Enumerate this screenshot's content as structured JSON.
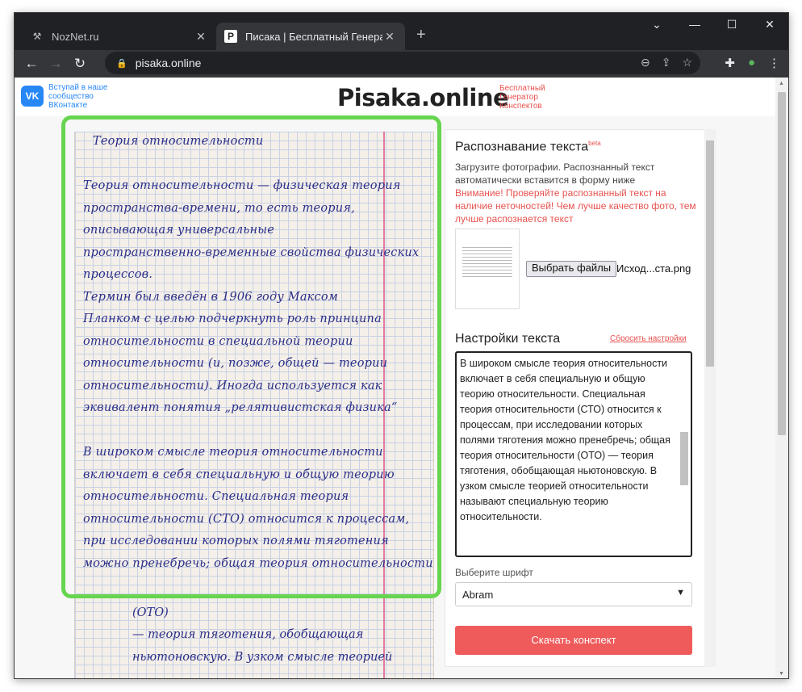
{
  "browser": {
    "tabs": [
      {
        "title": "NozNet.ru",
        "icon": "tools-icon",
        "active": false
      },
      {
        "title": "Писака | Бесплатный Генератор",
        "icon": "p-logo-icon",
        "active": true
      }
    ],
    "url": "pisaka.online"
  },
  "header": {
    "vk_label": "Вступай в наше сообщество ВКонтакте",
    "vk_badge": "VK",
    "logo": "Pisaka.online",
    "tagline": "Бесплатный Генератор Конспектов"
  },
  "preview": {
    "lines": [
      "Теория относительности",
      "",
      "Теория относительности — физическая теория",
      "пространства-времени, то есть теория,",
      "описывающая универсальные",
      "пространственно-временные свойства физических",
      "процессов.",
      "Термин был введён в 1906 году Максом",
      "Планком с целью подчеркнуть роль принципа",
      "относительности в специальной теории",
      "относительности (и, позже, общей — теории",
      "относительности). Иногда используется как",
      "эквивалент понятия „релятивистская физика“",
      "",
      "В широком смысле теория относительности",
      "включает в себя специальную и общую теорию",
      "относительности. Специальная теория",
      "относительности (СТО) относится к процессам,",
      "при исследовании которых полями тяготения",
      "можно пренебречь; общая теория относительности"
    ],
    "lower_lines": [
      "(ОТО)",
      "— теория тяготения, обобщающая",
      "ньютоновскую. В узком смысле теорией"
    ]
  },
  "panel": {
    "recognition_title": "Распознавание текста",
    "beta": "beta",
    "recognition_desc": "Загрузите фотографии. Распознанный текст автоматически вставится в форму ниже",
    "warning": "Внимание! Проверяйте распознанный текст на наличие неточностей! Чем лучше качество фото, тем лучше распознается текст",
    "file_button": "Выбрать файлы",
    "file_name": "Исход...ста.png",
    "settings_title": "Настройки текста",
    "reset_label": "Сбросить настройки",
    "textarea_value": "В широком смысле теория относительности включает в себя специальную и общую теорию относительности. Специальная теория относительности (СТО) относится к процессам, при исследовании которых полями тяготения можно пренебречь; общая теория относительности (ОТО) — теория тяготения, обобщающая ньютоновскую. В узком смысле теорией относительности называют специальную теорию относительности.",
    "font_label": "Выберите шрифт",
    "font_value": "Abram",
    "download_label": "Скачать конспект"
  },
  "colors": {
    "accent": "#ef5b5b",
    "highlight": "#67d54f",
    "vk": "#2787f5",
    "ink": "#2a2e88"
  }
}
